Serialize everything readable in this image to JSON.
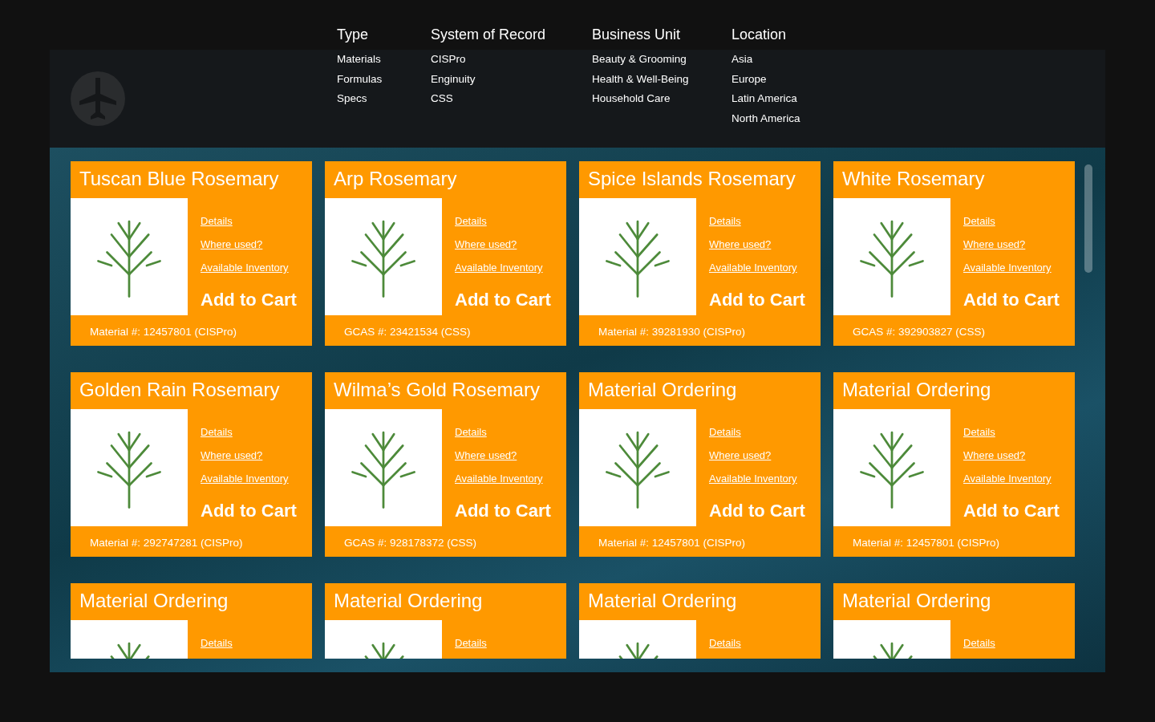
{
  "filters": [
    {
      "heading": "Type",
      "items": [
        "Materials",
        "Formulas",
        "Specs"
      ]
    },
    {
      "heading": "System of Record",
      "items": [
        "CISPro",
        "Enginuity",
        "CSS"
      ]
    },
    {
      "heading": "Business Unit",
      "items": [
        "Beauty & Grooming",
        "Health & Well-Being",
        "Household Care"
      ]
    },
    {
      "heading": "Location",
      "items": [
        "Asia",
        "Europe",
        "Latin America",
        "North America"
      ]
    }
  ],
  "cards": [
    {
      "title": "Tuscan Blue Rosemary",
      "links": [
        "Details",
        "Where used?",
        "Available Inventory"
      ],
      "action": "Add to Cart",
      "id_line": "Material #:  12457801 (CISPro)"
    },
    {
      "title": "Arp Rosemary",
      "links": [
        "Details",
        "Where used?",
        "Available Inventory"
      ],
      "action": "Add to Cart",
      "id_line": "GCAS #:  23421534 (CSS)"
    },
    {
      "title": "Spice Islands Rosemary",
      "links": [
        "Details",
        "Where used?",
        "Available Inventory"
      ],
      "action": "Add to Cart",
      "id_line": "Material #:  39281930 (CISPro)"
    },
    {
      "title": "White Rosemary",
      "links": [
        "Details",
        "Where used?",
        "Available Inventory"
      ],
      "action": "Add to Cart",
      "id_line": "GCAS #:  392903827 (CSS)"
    },
    {
      "title": "Golden Rain Rosemary",
      "links": [
        "Details",
        "Where used?",
        "Available Inventory"
      ],
      "action": "Add to Cart",
      "id_line": "Material #:  292747281  (CISPro)"
    },
    {
      "title": "Wilma’s Gold Rosemary",
      "links": [
        "Details",
        "Where used?",
        "Available Inventory"
      ],
      "action": "Add to Cart",
      "id_line": "GCAS #:  928178372 (CSS)"
    },
    {
      "title": "Material Ordering",
      "links": [
        "Details",
        "Where used?",
        "Available Inventory"
      ],
      "action": "Add to Cart",
      "id_line": "Material #:  12457801 (CISPro)"
    },
    {
      "title": "Material Ordering",
      "links": [
        "Details",
        "Where used?",
        "Available Inventory"
      ],
      "action": "Add to Cart",
      "id_line": "Material #:  12457801 (CISPro)"
    },
    {
      "title": "Material Ordering",
      "links": [
        "Details"
      ]
    },
    {
      "title": "Material Ordering",
      "links": [
        "Details"
      ]
    },
    {
      "title": "Material Ordering",
      "links": [
        "Details"
      ]
    },
    {
      "title": "Material Ordering",
      "links": [
        "Details"
      ]
    }
  ]
}
